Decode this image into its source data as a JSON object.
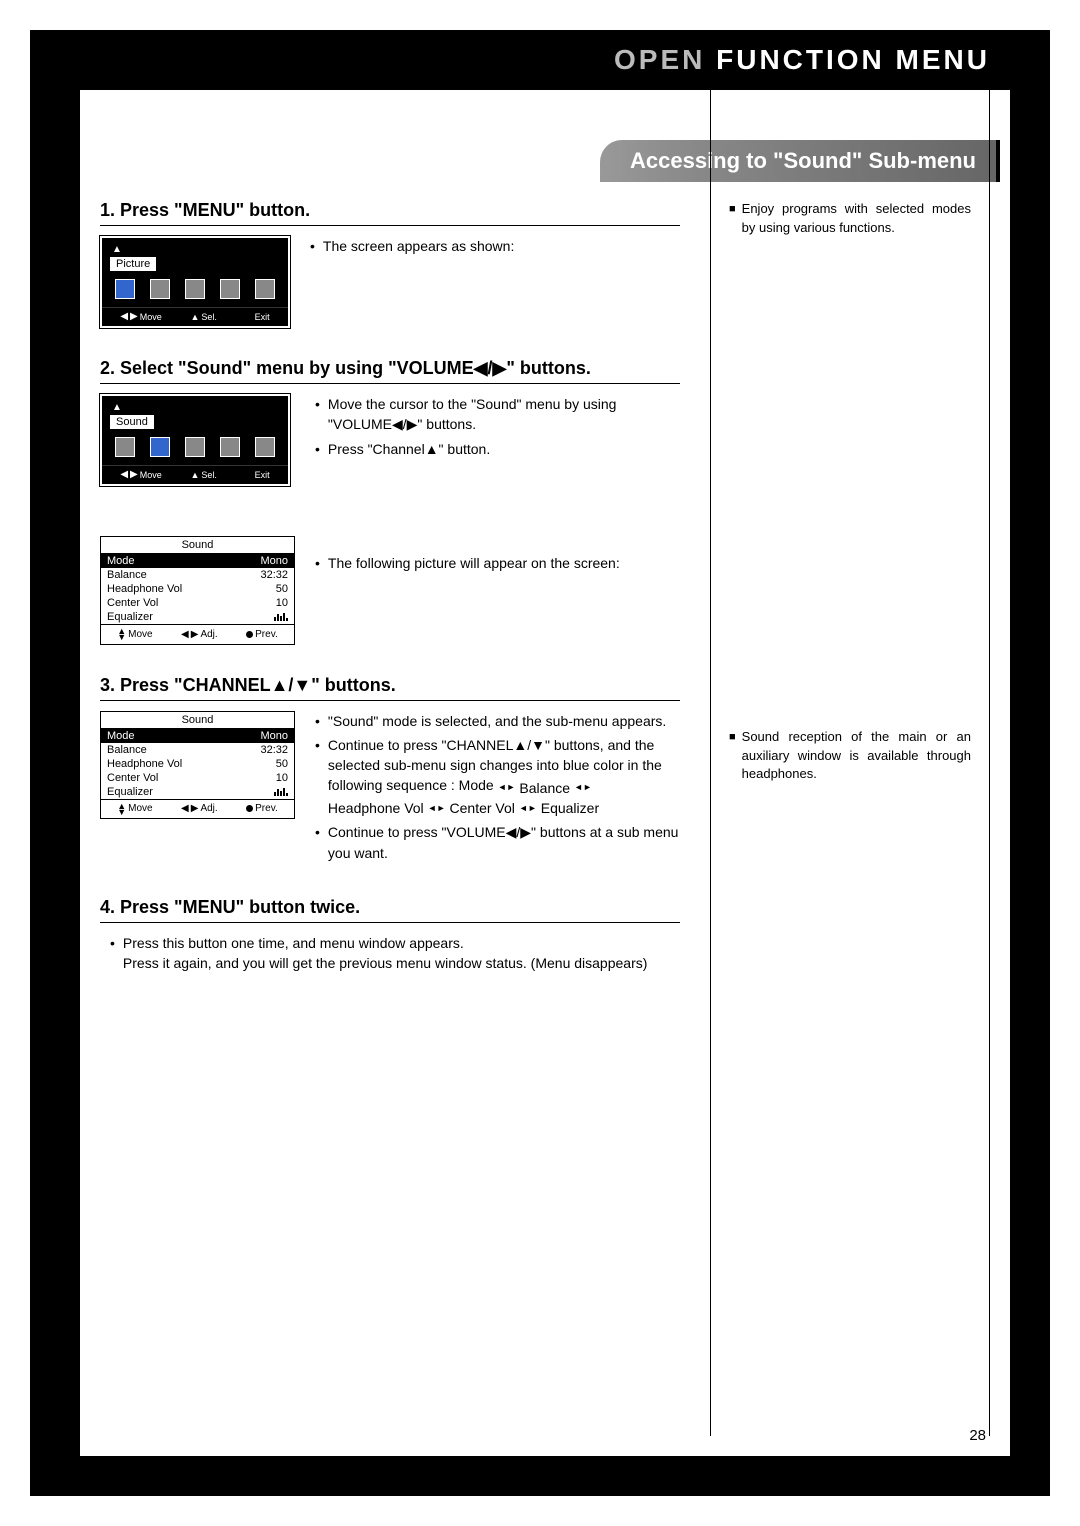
{
  "header": {
    "open": "OPEN",
    "title": "FUNCTION MENU"
  },
  "section_title": "Accessing to \"Sound\" Sub-menu",
  "page_number": "28",
  "notes": {
    "n1": "Enjoy programs with selected modes by using various functions.",
    "n2": "Sound reception of the main or an auxiliary window is available through headphones."
  },
  "step1": {
    "heading": "1. Press \"MENU\" button.",
    "text1": "The screen appears as shown:",
    "osd_label": "Picture",
    "hint_move": "Move",
    "hint_sel": "Sel.",
    "hint_exit": "Exit"
  },
  "step2": {
    "heading": "2. Select \"Sound\" menu by using \"VOLUME◀/▶\"  buttons.",
    "t1a": "Move the cursor to the \"Sound\" menu by using",
    "t1b": "\"VOLUME◀/▶\"  buttons.",
    "t2": "Press \"Channel▲\" button.",
    "t3": "The following picture will appear on the screen:",
    "osd_label": "Sound",
    "hint_move": "Move",
    "hint_sel": "Sel.",
    "hint_exit": "Exit",
    "sm": {
      "title": "Sound",
      "rows": [
        {
          "label": "Mode",
          "value": "Mono",
          "sel": true
        },
        {
          "label": "Balance",
          "value": "32:32"
        },
        {
          "label": "Headphone Vol",
          "value": "50"
        },
        {
          "label": "Center Vol",
          "value": "10"
        },
        {
          "label": "Equalizer",
          "value": ""
        }
      ],
      "f_move": "Move",
      "f_adj": "Adj.",
      "f_prev": "Prev."
    }
  },
  "step3": {
    "heading": "3. Press \"CHANNEL▲/▼\" buttons.",
    "t1": "\"Sound\" mode is selected, and the sub-menu appears.",
    "t2a": "Continue to press \"CHANNEL▲/▼\" buttons, and the selected sub-menu sign changes into blue color in the following sequence : Mode",
    "seq": [
      "Mode",
      "Balance",
      "Headphone Vol",
      "Center Vol",
      "Equalizer"
    ],
    "t3": "Continue to press \"VOLUME◀/▶\" buttons at a sub menu you want.",
    "sm": {
      "title": "Sound",
      "rows": [
        {
          "label": "Mode",
          "value": "Mono",
          "sel": true
        },
        {
          "label": "Balance",
          "value": "32:32"
        },
        {
          "label": "Headphone Vol",
          "value": "50"
        },
        {
          "label": "Center Vol",
          "value": "10"
        },
        {
          "label": "Equalizer",
          "value": ""
        }
      ],
      "f_move": "Move",
      "f_adj": "Adj.",
      "f_prev": "Prev."
    }
  },
  "step4": {
    "heading": "4. Press \"MENU\" button twice.",
    "t1": "Press this button one time, and menu window appears.",
    "t2": "Press it again, and you will get the previous menu window status. (Menu disappears)"
  }
}
